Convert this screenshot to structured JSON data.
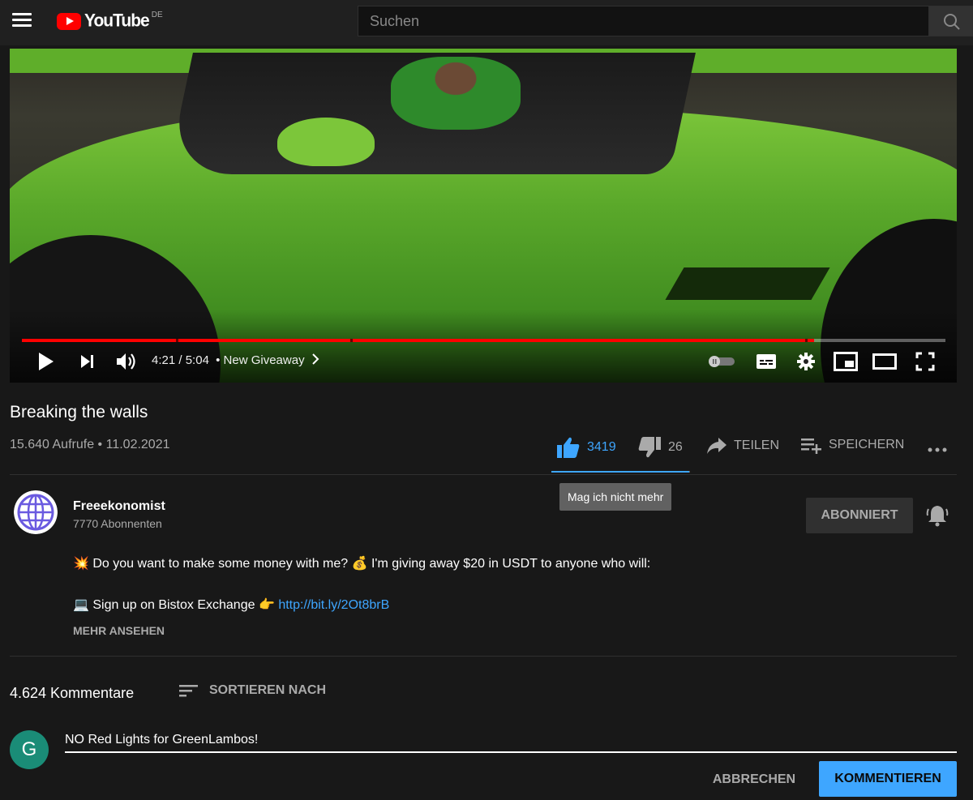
{
  "header": {
    "brand": "YouTube",
    "region": "DE",
    "search_placeholder": "Suchen"
  },
  "player": {
    "current_time": "4:21",
    "duration": "5:04",
    "separator": "/",
    "chapter_dot": "•",
    "chapter": "New Giveaway",
    "progress_fraction": 0.858
  },
  "video": {
    "title": "Breaking the walls",
    "views": "15.640 Aufrufe",
    "date": "11.02.2021",
    "meta_sep": "•",
    "likes": "3419",
    "dislikes": "26",
    "like_ratio": 0.992,
    "share_label": "TEILEN",
    "save_label": "SPEICHERN",
    "tooltip": "Mag ich nicht mehr"
  },
  "channel": {
    "name": "Freeekonomist",
    "subscribers": "7770 Abonnenten",
    "subscribe_label": "ABONNIERT"
  },
  "description": {
    "line1": "💥 Do you want to make some money with me? 💰 I'm giving away $20 in USDT to anyone who will:",
    "line2_text": "💻 Sign up on Bistox Exchange 👉 ",
    "line2_link": "http://bit.ly/2Ot8brB",
    "more_label": "MEHR ANSEHEN"
  },
  "comments": {
    "count": "4.624 Kommentare",
    "sort_label": "SORTIEREN NACH",
    "user_initial": "G",
    "draft": "NO Red Lights for GreenLambos!",
    "cancel_label": "ABBRECHEN",
    "submit_label": "KOMMENTIEREN"
  },
  "colors": {
    "accent_blue": "#3ea6ff",
    "progress_red": "#ff0000",
    "avatar_green": "#1a8c77",
    "channel_purple": "#6a5ae0"
  }
}
